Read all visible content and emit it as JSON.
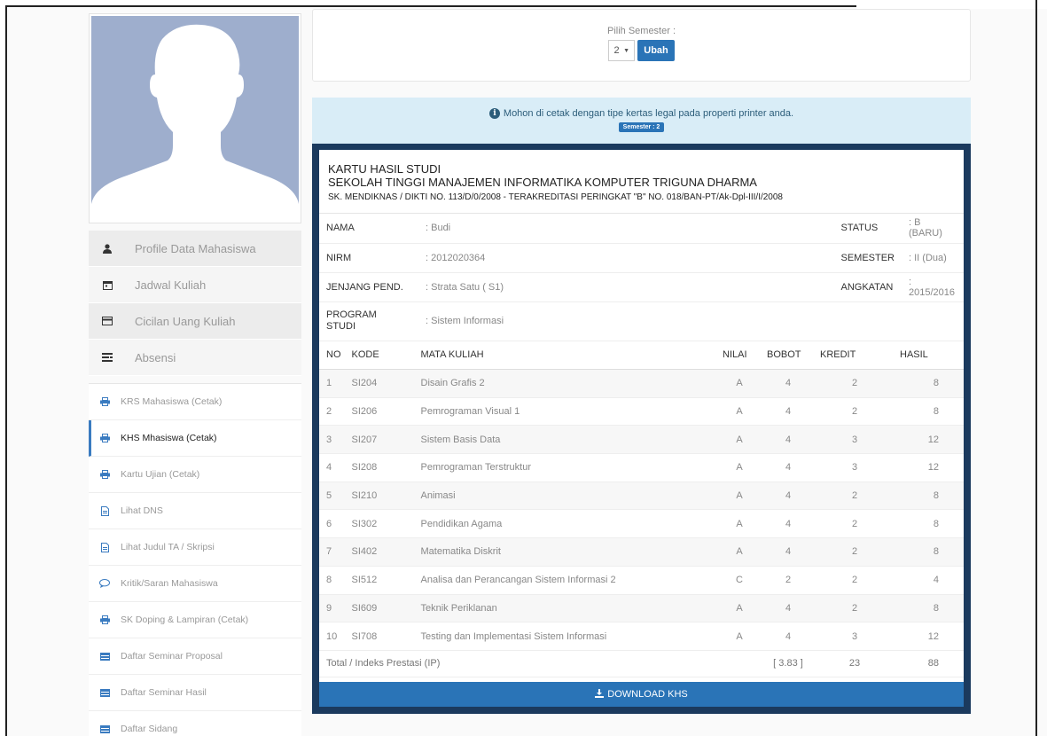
{
  "sidebar": {
    "profile_menu": [
      {
        "label": "Profile Data Mahasiswa",
        "icon": "user-icon"
      },
      {
        "label": "Jadwal Kuliah",
        "icon": "calendar-icon"
      },
      {
        "label": "Cicilan Uang Kuliah",
        "icon": "card-icon"
      },
      {
        "label": "Absensi",
        "icon": "list-icon"
      }
    ],
    "nav_menu": [
      {
        "label": "KRS Mahasiswa (Cetak)",
        "icon": "printer-icon"
      },
      {
        "label": "KHS Mhasiswa (Cetak)",
        "icon": "printer-icon",
        "active": true
      },
      {
        "label": "Kartu Ujian (Cetak)",
        "icon": "printer-icon"
      },
      {
        "label": "Lihat DNS",
        "icon": "file-icon"
      },
      {
        "label": "Lihat Judul TA / Skripsi",
        "icon": "file-icon"
      },
      {
        "label": "Kritik/Saran Mahasiswa",
        "icon": "comment-icon"
      },
      {
        "label": "SK Doping & Lampiran (Cetak)",
        "icon": "printer-icon"
      },
      {
        "label": "Daftar Seminar Proposal",
        "icon": "table-icon"
      },
      {
        "label": "Daftar Seminar Hasil",
        "icon": "table-icon"
      },
      {
        "label": "Daftar Sidang",
        "icon": "table-icon"
      }
    ]
  },
  "semester": {
    "label": "Pilih Semester :",
    "selected": "2",
    "button": "Ubah"
  },
  "notice": {
    "text": "Mohon di cetak dengan tipe kertas legal pada properti printer anda.",
    "badge": "Semester : 2"
  },
  "card": {
    "title1": "KARTU HASIL STUDI",
    "title2": "SEKOLAH TINGGI MANAJEMEN INFORMATIKA KOMPUTER TRIGUNA DHARMA",
    "title3": "SK. MENDIKNAS / DIKTI NO. 113/D/0/2008 - TERAKREDITASI PERINGKAT \"B\" NO. 018/BAN-PT/Ak-Dpl-III/I/2008",
    "info": {
      "nama_label": "NAMA",
      "nama_value": ": Budi",
      "status_label": "STATUS",
      "status_value": ": B (BARU)",
      "nirm_label": "NIRM",
      "nirm_value": ": 2012020364",
      "semester_label": "SEMESTER",
      "semester_value": ": II (Dua)",
      "jenjang_label": "JENJANG PEND.",
      "jenjang_value": ": Strata Satu ( S1)",
      "angkatan_label": "ANGKATAN",
      "angkatan_value": ": 2015/2016",
      "prodi_label": "PROGRAM STUDI",
      "prodi_value": ": Sistem Informasi"
    },
    "columns": {
      "no": "NO",
      "kode": "KODE",
      "mk": "MATA KULIAH",
      "nilai": "NILAI",
      "bobot": "BOBOT",
      "kredit": "KREDIT",
      "hasil": "HASIL"
    },
    "rows": [
      {
        "no": "1",
        "kode": "SI204",
        "mk": "Disain Grafis 2",
        "nilai": "A",
        "bobot": "4",
        "kredit": "2",
        "hasil": "8"
      },
      {
        "no": "2",
        "kode": "SI206",
        "mk": "Pemrograman Visual 1",
        "nilai": "A",
        "bobot": "4",
        "kredit": "2",
        "hasil": "8"
      },
      {
        "no": "3",
        "kode": "SI207",
        "mk": "Sistem Basis Data",
        "nilai": "A",
        "bobot": "4",
        "kredit": "3",
        "hasil": "12"
      },
      {
        "no": "4",
        "kode": "SI208",
        "mk": "Pemrograman Terstruktur",
        "nilai": "A",
        "bobot": "4",
        "kredit": "3",
        "hasil": "12"
      },
      {
        "no": "5",
        "kode": "SI210",
        "mk": "Animasi",
        "nilai": "A",
        "bobot": "4",
        "kredit": "2",
        "hasil": "8"
      },
      {
        "no": "6",
        "kode": "SI302",
        "mk": "Pendidikan Agama",
        "nilai": "A",
        "bobot": "4",
        "kredit": "2",
        "hasil": "8"
      },
      {
        "no": "7",
        "kode": "SI402",
        "mk": "Matematika Diskrit",
        "nilai": "A",
        "bobot": "4",
        "kredit": "2",
        "hasil": "8"
      },
      {
        "no": "8",
        "kode": "SI512",
        "mk": "Analisa dan Perancangan Sistem Informasi 2",
        "nilai": "C",
        "bobot": "2",
        "kredit": "2",
        "hasil": "4"
      },
      {
        "no": "9",
        "kode": "SI609",
        "mk": "Teknik Periklanan",
        "nilai": "A",
        "bobot": "4",
        "kredit": "2",
        "hasil": "8"
      },
      {
        "no": "10",
        "kode": "SI708",
        "mk": "Testing dan Implementasi Sistem Informasi",
        "nilai": "A",
        "bobot": "4",
        "kredit": "3",
        "hasil": "12"
      }
    ],
    "total_label": "Total / Indeks Prestasi (IP)",
    "ip": "[ 3.83 ]",
    "total_kredit": "23",
    "total_hasil": "88",
    "download": "DOWNLOAD KHS"
  },
  "colors": {
    "accent": "#2a74b7",
    "card_border": "#1b3a5e",
    "notice_bg": "#d9edf7"
  }
}
